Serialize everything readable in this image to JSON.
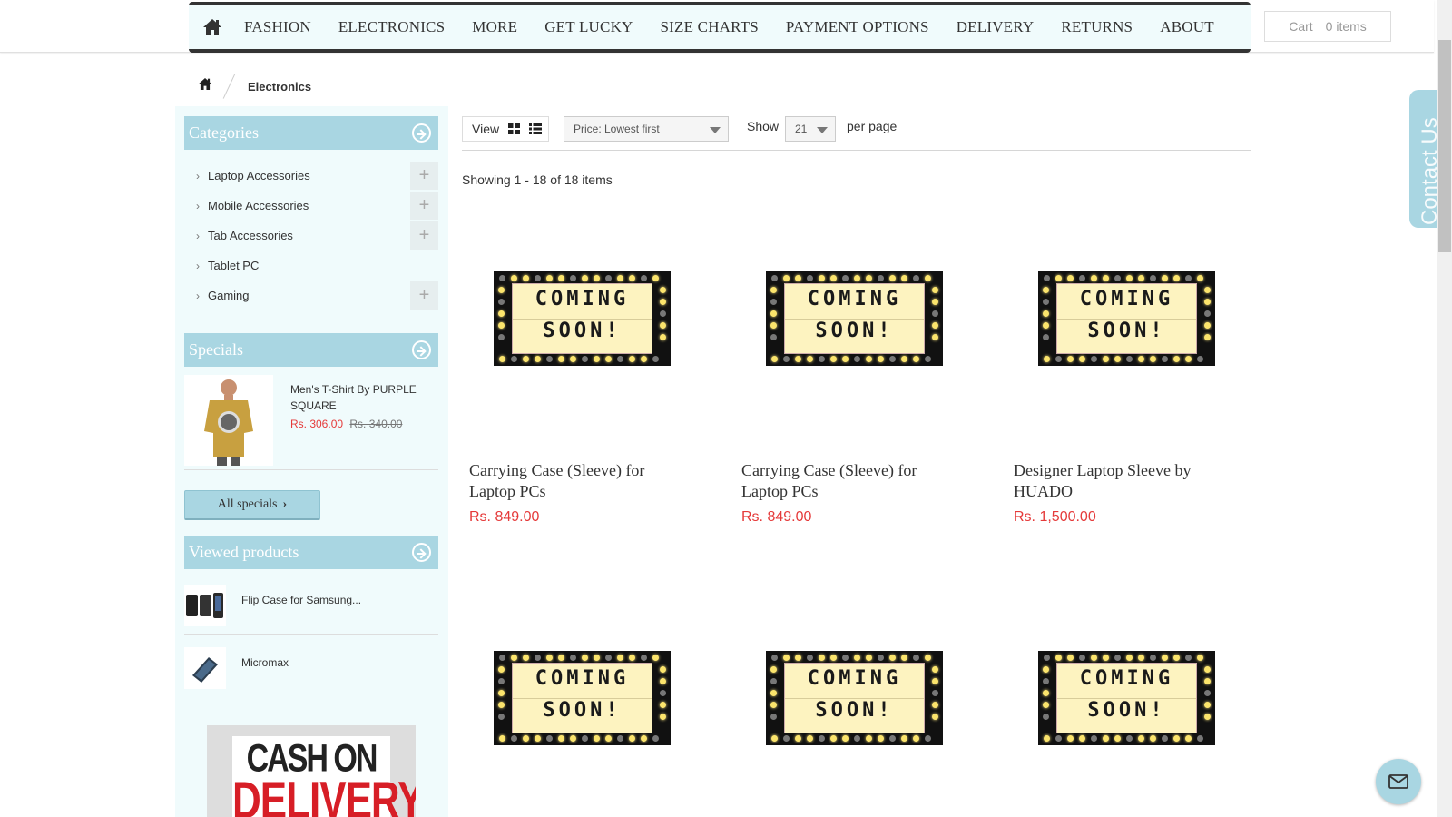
{
  "nav": {
    "items": [
      "FASHION",
      "ELECTRONICS",
      "MORE",
      "GET LUCKY",
      "SIZE CHARTS",
      "PAYMENT OPTIONS",
      "DELIVERY",
      "RETURNS",
      "ABOUT"
    ]
  },
  "cart": {
    "label": "Cart",
    "count": "0 items"
  },
  "breadcrumb": {
    "current": "Electronics"
  },
  "categories": {
    "title": "Categories",
    "items": [
      {
        "label": "Laptop Accessories",
        "expandable": true
      },
      {
        "label": "Mobile Accessories",
        "expandable": true
      },
      {
        "label": "Tab Accessories",
        "expandable": true
      },
      {
        "label": "Tablet PC",
        "expandable": false
      },
      {
        "label": "Gaming",
        "expandable": true
      }
    ]
  },
  "specials": {
    "title": "Specials",
    "item": {
      "name": "Men's T-Shirt By PURPLE SQUARE",
      "price": "Rs. 306.00",
      "old_price": "Rs. 340.00"
    },
    "button": "All specials"
  },
  "viewed": {
    "title": "Viewed products",
    "items": [
      {
        "name": "Flip Case for Samsung..."
      },
      {
        "name": "Micromax"
      }
    ]
  },
  "cod_banner": {
    "line1": "CASH ON",
    "line2": "DELIVERY"
  },
  "toolbar": {
    "view_label": "View",
    "sort_value": "Price: Lowest first",
    "show_label": "Show",
    "per_page_value": "21",
    "per_page_label": "per page"
  },
  "listing": {
    "showing": "Showing 1 - 18 of 18 items"
  },
  "products": [
    {
      "name": "Carrying Case (Sleeve) for Laptop PCs",
      "price": "Rs. 849.00",
      "image_text": [
        "COMING",
        "SOON!"
      ]
    },
    {
      "name": "Carrying Case (Sleeve) for Laptop PCs",
      "price": "Rs. 849.00",
      "image_text": [
        "COMING",
        "SOON!"
      ]
    },
    {
      "name": "Designer Laptop Sleeve by HUADO",
      "price": "Rs. 1,500.00",
      "image_text": [
        "COMING",
        "SOON!"
      ]
    },
    {
      "name": "",
      "price": "",
      "image_text": [
        "COMING",
        "SOON!"
      ]
    },
    {
      "name": "",
      "price": "",
      "image_text": [
        "COMING",
        "SOON!"
      ]
    },
    {
      "name": "",
      "price": "",
      "image_text": [
        "COMING",
        "SOON!"
      ]
    }
  ],
  "contact_tab": {
    "label": "Contact Us"
  },
  "colors": {
    "accent": "#a9d6e2",
    "panel": "#f0fbfc",
    "price": "#e53a3a",
    "nav_border": "#333333"
  },
  "icons": {
    "home": "home-icon",
    "grid": "grid-view-icon",
    "list": "list-view-icon",
    "mail": "mail-icon"
  }
}
